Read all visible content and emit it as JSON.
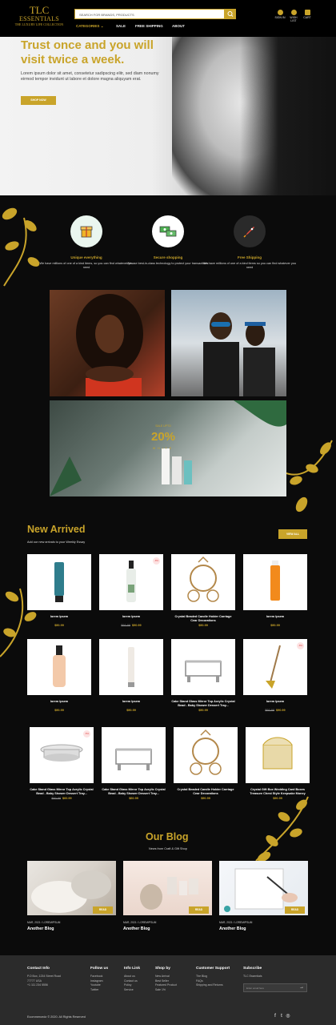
{
  "header": {
    "logo": {
      "line1": "TLC",
      "line2": "ESSENTIALS",
      "line3": "THE LUXURY LIFE COLLECTION"
    },
    "search_placeholder": "Search for brands, products",
    "icons": [
      {
        "name": "user-icon",
        "label": "SIGN IN"
      },
      {
        "name": "heart-icon",
        "label": "WISH LIST"
      },
      {
        "name": "cart-icon",
        "label": "CART"
      }
    ],
    "nav": [
      {
        "label": "CATEGORIES",
        "active": true
      },
      {
        "label": "SALE",
        "active": false
      },
      {
        "label": "FREE SHIPPING",
        "active": false
      },
      {
        "label": "ABOUT",
        "active": false
      }
    ]
  },
  "hero": {
    "title": "Trust once and you will visit twice a week.",
    "text": "Lorem ipsum dolor sit amet, consetetur sadipscing elitr, sed diam nonumy eirmod tempor invidunt ut labore et dolore magna aliquyam erat.",
    "button": "Shop Now"
  },
  "features": [
    {
      "title": "Unique everything",
      "text": "We have millions of one of a kind items, so you can find whatever you need",
      "icon": "gift-icon"
    },
    {
      "title": "Secure shopping",
      "text": "We use best-in-class technology to protect your transactions.",
      "icon": "money-icon"
    },
    {
      "title": "Free Shipping",
      "text": "We have millions of one of a kind items so you can find whatever you need",
      "icon": "rocket-icon"
    }
  ],
  "promo": {
    "label": "SALE UPTO",
    "percent": "20%",
    "brand": "WHITE"
  },
  "new_arrived": {
    "title": "New Arrived",
    "subtitle": "Add our new arrivals to your Weekly Essay",
    "button": "View All",
    "products": [
      {
        "name": "lorem Ipsem",
        "old_price": "",
        "price": "$90.99",
        "badge": "",
        "img": "tube"
      },
      {
        "name": "lorem Ipsem",
        "old_price": "$60.99",
        "price": "$90.99",
        "badge": "-8%",
        "img": "spray"
      },
      {
        "name": "Crystal Beaded Candle Holder Carriage Cear Decorations",
        "old_price": "",
        "price": "$90.99",
        "badge": "",
        "img": "carriage"
      },
      {
        "name": "lorem Ipsem",
        "old_price": "",
        "price": "$90.99",
        "badge": "",
        "img": "orange"
      },
      {
        "name": "lorem Ipsem",
        "old_price": "",
        "price": "$90.99",
        "badge": "",
        "img": "bottle"
      },
      {
        "name": "lorem Ipsem",
        "old_price": "",
        "price": "$90.99",
        "badge": "",
        "img": "slim"
      },
      {
        "name": "Cake Stand Glass Mirror Top Acrylic Crystal Bead - Baby Shower Dessert Tray...",
        "old_price": "",
        "price": "$90.99",
        "badge": "",
        "img": "tray"
      },
      {
        "name": "lorem Ipsem",
        "old_price": "$60.99",
        "price": "$90.99",
        "badge": "-8%",
        "img": "brush"
      },
      {
        "name": "Cake Stand Glass Mirror Top Acrylic Crystal Bead - Baby Shower Dessert Tray...",
        "old_price": "$60.99",
        "price": "$60.99",
        "badge": "-5%",
        "img": "stand"
      },
      {
        "name": "Cake Stand Glass Mirror Top Acrylic Crystal Bead - Baby Shower Dessert Tray...",
        "old_price": "",
        "price": "$60.99",
        "badge": "",
        "img": "tray"
      },
      {
        "name": "Crystal Beaded Candle Holder Carriage Cear Decorations",
        "old_price": "",
        "price": "$90.99",
        "badge": "",
        "img": "carriage"
      },
      {
        "name": "Crystal Gift Box Wedding Card Boxes Treasure Chest Style Keepsake Money",
        "old_price": "",
        "price": "$90.99",
        "badge": "",
        "img": "box"
      }
    ]
  },
  "blog": {
    "title": "Our Blog",
    "subtitle": "News from Craft & Gift Shop",
    "posts": [
      {
        "meta": "MAR, 2021 / LOREMIPSUM",
        "title": "Another Blog",
        "button": "Read"
      },
      {
        "meta": "MAR, 2021 / LOREMIPSUM",
        "title": "Another Blog",
        "button": "Read"
      },
      {
        "meta": "MAR, 2021 / LOREMIPSUM",
        "title": "Another Blog",
        "button": "Read"
      }
    ]
  },
  "footer": {
    "columns": [
      {
        "title": "Contact Info",
        "links": [
          "P.O Box, 1234 Street Road",
          "77777 USA",
          "+1 111 234 5556"
        ]
      },
      {
        "title": "Follow us",
        "links": [
          "Facebook",
          "Instagram",
          "Youtube",
          "Twitter"
        ]
      },
      {
        "title": "Info Link",
        "links": [
          "About us",
          "Contact us",
          "Policy",
          "Service"
        ]
      },
      {
        "title": "Shop by",
        "links": [
          "New Arrival",
          "Best Seller",
          "Featured Product",
          "Sale 1%"
        ]
      },
      {
        "title": "Customer Support",
        "links": [
          "The Blog",
          "FAQs",
          "Shipping and Returns"
        ]
      },
      {
        "title": "Subscribe",
        "links": [
          "TLC Essentials"
        ]
      }
    ],
    "subscribe_placeholder": "Enter email here",
    "copyright": "Ecommercedz © 2020. All Rights Reserved",
    "social": [
      "facebook-icon",
      "twitter-icon",
      "instagram-icon"
    ]
  },
  "colors": {
    "accent": "#c9a42a",
    "background": "#0b0b0b",
    "footer": "#2b2b2b"
  }
}
